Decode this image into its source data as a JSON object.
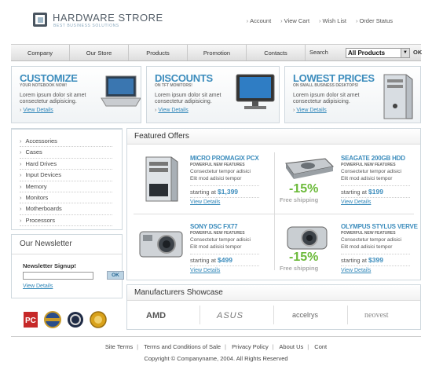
{
  "header": {
    "logo_title": "HARDWARE STRORE",
    "logo_subtitle": "BEST BUSINESS SOLUTIONS",
    "top_links": [
      "Account",
      "View Cart",
      "Wish List",
      "Order Status"
    ]
  },
  "nav": {
    "items": [
      "Company",
      "Our Store",
      "Products",
      "Promotion",
      "Contacts"
    ],
    "search_label": "Search",
    "search_select_value": "All Products",
    "ok_label": "OK"
  },
  "promos": [
    {
      "title": "CUSTOMIZE",
      "subtitle": "YOUR NOTEBOOK NOW!",
      "text": "Lorem ipsum dolor sit amet consectetur adipisicing.",
      "link": "View Details"
    },
    {
      "title": "DISCOUNTS",
      "subtitle": "ON TFT MONITORS!",
      "text": "Lorem ipsum dolor sit amet consectetur adipisicing.",
      "link": "View Details"
    },
    {
      "title": "LOWEST PRICES",
      "subtitle": "ON SMALL BUSINESS DESKTOPS!",
      "text": "Lorem ipsum dolor sit amet consectetur adipisicing.",
      "link": "View Details"
    }
  ],
  "sidebar": {
    "categories": [
      "Accessories",
      "Cases",
      "Hard Drives",
      "Input Devices",
      "Memory",
      "Monitors",
      "Motherboards",
      "Processors"
    ]
  },
  "newsletter": {
    "title": "Our Newsletter",
    "label": "Newsletter Signup!",
    "input_value": "",
    "button": "OK",
    "link": "View Details"
  },
  "featured": {
    "title": "Featured Offers",
    "products": [
      {
        "name": "MICRO PROMAGIX PCX",
        "features": "POWERFUL NEW FEATURES",
        "desc1": "Consectetur tempor adisici",
        "desc2": "Elit mod adisici tempor",
        "price_label": "starting at",
        "price": "$1,399",
        "link": "View Details",
        "discount": "",
        "shipping": ""
      },
      {
        "name": "SEAGATE 200GB HDD",
        "features": "POWERFUL NEW FEATURES",
        "desc1": "Consectetur tempor adisici",
        "desc2": "Elit mod adisici tempor",
        "price_label": "starting at",
        "price": "$199",
        "link": "View Details",
        "discount": "-15%",
        "shipping": "Free shipping"
      },
      {
        "name": "SONY DSC FX77",
        "features": "POWERFUL NEW FEATURES",
        "desc1": "Consectetur tempor adisici",
        "desc2": "Elit mod adisici tempor",
        "price_label": "starting at",
        "price": "$499",
        "link": "View Details",
        "discount": "",
        "shipping": ""
      },
      {
        "name": "OLYMPUS STYLUS VERVE",
        "features": "POWERFUL NEW FEATURES",
        "desc1": "Consectetur tempor adisici",
        "desc2": "Elit mod adisici tempor",
        "price_label": "starting at",
        "price": "$399",
        "link": "View Details",
        "discount": "-15%",
        "shipping": "Free shipping"
      }
    ]
  },
  "manufacturers": {
    "title": "Manufacturers Showcase",
    "logos": [
      "AMD",
      "ASUS",
      "accelrys",
      "neovest"
    ]
  },
  "footer": {
    "links": [
      "Site Terms",
      "Terms and Conditions of Sale",
      "Privacy Policy",
      "About Us",
      "Cont"
    ],
    "copyright": "Copyright © Companyname, 2004. All Rights Reserved"
  },
  "colors": {
    "accent": "#3d8dbd",
    "discount": "#6cba3a",
    "border": "#cfd8de"
  }
}
